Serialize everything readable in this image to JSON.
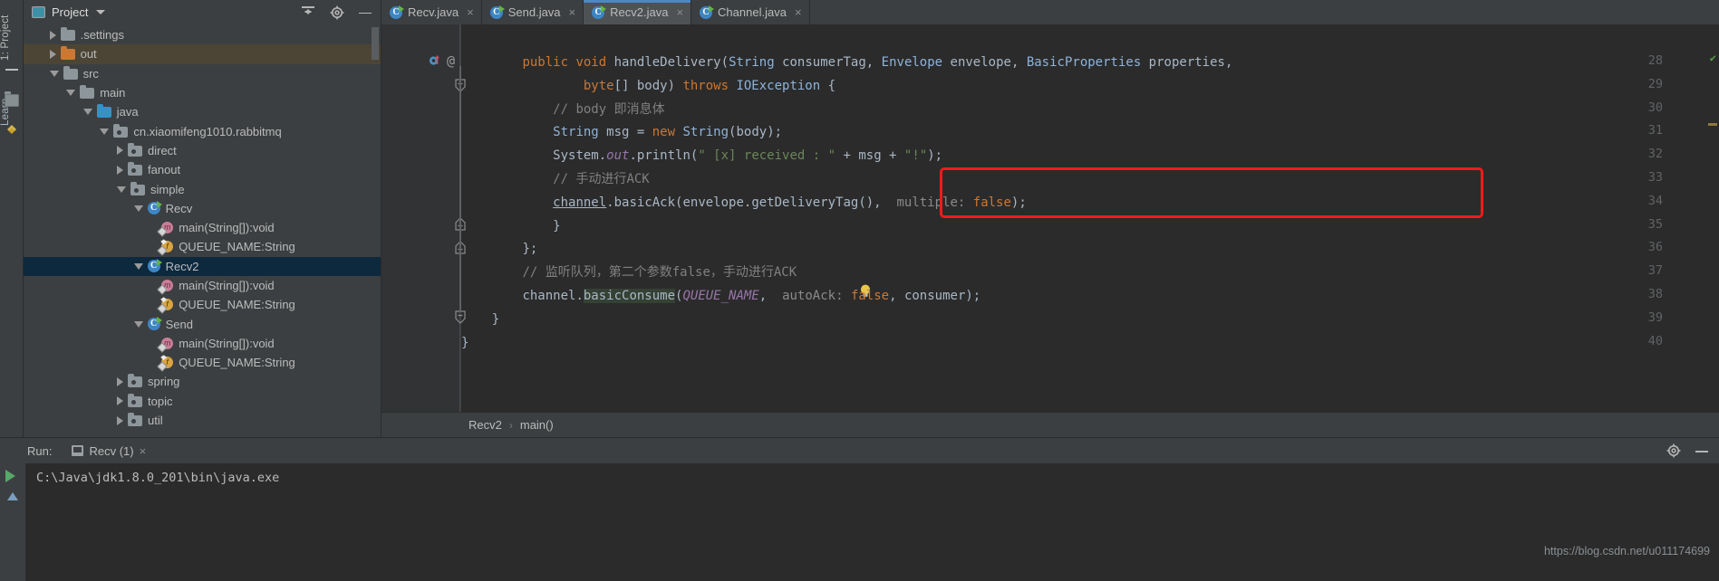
{
  "window": {
    "left_tool_tabs": [
      {
        "label": "1: Project",
        "icon": "project-icon"
      },
      {
        "label": "Learn",
        "icon": "learn-icon"
      }
    ]
  },
  "project_panel": {
    "title": "Project",
    "dropdown_icon": "chevron-down-icon",
    "actions": [
      {
        "name": "collapse-all-icon",
        "label": ""
      },
      {
        "name": "gear-icon",
        "label": ""
      },
      {
        "name": "hide-icon",
        "label": ""
      }
    ],
    "tree": [
      {
        "label": ".settings",
        "indent": 1,
        "arrow": "right",
        "icon": "folder",
        "state": "normal"
      },
      {
        "label": "out",
        "indent": 1,
        "arrow": "right",
        "icon": "folder-orange",
        "state": "out-highlight"
      },
      {
        "label": "src",
        "indent": 1,
        "arrow": "down",
        "icon": "folder",
        "state": "normal"
      },
      {
        "label": "main",
        "indent": 2,
        "arrow": "down",
        "icon": "folder",
        "state": "normal"
      },
      {
        "label": "java",
        "indent": 3,
        "arrow": "down",
        "icon": "folder-blue",
        "state": "normal"
      },
      {
        "label": "cn.xiaomifeng1010.rabbitmq",
        "indent": 4,
        "arrow": "down",
        "icon": "package",
        "state": "normal"
      },
      {
        "label": "direct",
        "indent": 5,
        "arrow": "right",
        "icon": "package",
        "state": "normal"
      },
      {
        "label": "fanout",
        "indent": 5,
        "arrow": "right",
        "icon": "package",
        "state": "normal"
      },
      {
        "label": "simple",
        "indent": 5,
        "arrow": "down",
        "icon": "package",
        "state": "normal"
      },
      {
        "label": "Recv",
        "indent": 6,
        "arrow": "down",
        "icon": "class",
        "state": "normal"
      },
      {
        "label": "main(String[]):void",
        "indent": 7,
        "arrow": "none",
        "icon": "method",
        "state": "normal"
      },
      {
        "label": "QUEUE_NAME:String",
        "indent": 7,
        "arrow": "none",
        "icon": "field",
        "state": "normal"
      },
      {
        "label": "Recv2",
        "indent": 6,
        "arrow": "down",
        "icon": "class",
        "state": "selected"
      },
      {
        "label": "main(String[]):void",
        "indent": 7,
        "arrow": "none",
        "icon": "method",
        "state": "normal"
      },
      {
        "label": "QUEUE_NAME:String",
        "indent": 7,
        "arrow": "none",
        "icon": "field",
        "state": "normal"
      },
      {
        "label": "Send",
        "indent": 6,
        "arrow": "down",
        "icon": "class",
        "state": "normal"
      },
      {
        "label": "main(String[]):void",
        "indent": 7,
        "arrow": "none",
        "icon": "method",
        "state": "normal"
      },
      {
        "label": "QUEUE_NAME:String",
        "indent": 7,
        "arrow": "none",
        "icon": "field",
        "state": "normal"
      },
      {
        "label": "spring",
        "indent": 5,
        "arrow": "right",
        "icon": "package",
        "state": "normal"
      },
      {
        "label": "topic",
        "indent": 5,
        "arrow": "right",
        "icon": "package",
        "state": "normal"
      },
      {
        "label": "util",
        "indent": 5,
        "arrow": "right",
        "icon": "package",
        "state": "normal"
      }
    ]
  },
  "editor": {
    "tabs": [
      {
        "label": "Recv.java",
        "active": false,
        "icon": "java-class-icon",
        "close": "×"
      },
      {
        "label": "Send.java",
        "active": false,
        "icon": "java-class-icon",
        "close": "×"
      },
      {
        "label": "Recv2.java",
        "active": true,
        "icon": "java-class-icon",
        "close": "×"
      },
      {
        "label": "Channel.java",
        "active": false,
        "icon": "java-class-icon",
        "close": "×"
      }
    ],
    "line_numbers": [
      "28",
      "29",
      "30",
      "31",
      "32",
      "33",
      "34",
      "35",
      "36",
      "37",
      "38",
      "39",
      "40"
    ],
    "code": {
      "l28": {
        "indent": "        ",
        "parts": [
          {
            "t": "public ",
            "c": "kw"
          },
          {
            "t": "void ",
            "c": "kw"
          },
          {
            "t": "handleDelivery",
            "c": "plain"
          },
          {
            "t": "(",
            "c": "plain"
          },
          {
            "t": "String",
            "c": "cls"
          },
          {
            "t": " consumerTag, ",
            "c": "plain"
          },
          {
            "t": "Envelope",
            "c": "cls"
          },
          {
            "t": " envelope, ",
            "c": "plain"
          },
          {
            "t": "BasicProperties",
            "c": "cls"
          },
          {
            "t": " properties,",
            "c": "plain"
          }
        ]
      },
      "l29": {
        "indent": "                ",
        "parts": [
          {
            "t": "byte",
            "c": "kw"
          },
          {
            "t": "[] body) ",
            "c": "plain"
          },
          {
            "t": "throws ",
            "c": "kw"
          },
          {
            "t": "IOException",
            "c": "cls"
          },
          {
            "t": " {",
            "c": "plain"
          }
        ]
      },
      "l30": {
        "indent": "            ",
        "parts": [
          {
            "t": "// body 即消息体",
            "c": "cmt"
          }
        ]
      },
      "l31": {
        "indent": "            ",
        "parts": [
          {
            "t": "String",
            "c": "cls"
          },
          {
            "t": " msg = ",
            "c": "plain"
          },
          {
            "t": "new ",
            "c": "kw"
          },
          {
            "t": "String",
            "c": "cls"
          },
          {
            "t": "(body);",
            "c": "plain"
          }
        ]
      },
      "l32": {
        "indent": "            ",
        "parts": [
          {
            "t": "System.",
            "c": "plain"
          },
          {
            "t": "out",
            "c": "stc"
          },
          {
            "t": ".println(",
            "c": "plain"
          },
          {
            "t": "\" [x] received : \"",
            "c": "str"
          },
          {
            "t": " + msg + ",
            "c": "plain"
          },
          {
            "t": "\"!\"",
            "c": "str"
          },
          {
            "t": ");",
            "c": "plain"
          }
        ]
      },
      "l33": {
        "indent": "            ",
        "parts": [
          {
            "t": "// 手动进行ACK",
            "c": "cmt"
          }
        ]
      },
      "l34": {
        "indent": "            ",
        "parts": [
          {
            "t": "channel",
            "c": "ident-u"
          },
          {
            "t": ".basicAck(envelope.getDeliveryTag(),  ",
            "c": "plain"
          },
          {
            "t": "multiple:",
            "c": "hint"
          },
          {
            "t": " ",
            "c": "plain"
          },
          {
            "t": "false",
            "c": "kw"
          },
          {
            "t": ");",
            "c": "plain"
          }
        ]
      },
      "l35": {
        "indent": "            ",
        "parts": [
          {
            "t": "}",
            "c": "plain"
          }
        ]
      },
      "l36": {
        "indent": "        ",
        "parts": [
          {
            "t": "};",
            "c": "plain"
          }
        ]
      },
      "l37": {
        "indent": "        ",
        "parts": [
          {
            "t": "// 监听队列，第二个参数false，手动进行ACK",
            "c": "cmt"
          }
        ]
      },
      "l38": {
        "indent": "        ",
        "parts": [
          {
            "t": "channel.",
            "c": "plain"
          },
          {
            "t": "basicConsume",
            "c": "cc-hl"
          },
          {
            "t": "(",
            "c": "plain"
          },
          {
            "t": "QUEUE_NAME",
            "c": "constant"
          },
          {
            "t": ",  ",
            "c": "plain"
          },
          {
            "t": "autoAck:",
            "c": "hint"
          },
          {
            "t": " ",
            "c": "plain"
          },
          {
            "t": "false",
            "c": "kw"
          },
          {
            "t": ", consumer);",
            "c": "plain"
          }
        ]
      },
      "l39": {
        "indent": "    ",
        "parts": [
          {
            "t": "}",
            "c": "plain"
          }
        ]
      },
      "l40": {
        "indent": "",
        "parts": [
          {
            "t": "}",
            "c": "plain"
          }
        ]
      }
    },
    "annotation": {
      "name": "red-highlight-box",
      "color": "#f41a1a",
      "covers_lines": [
        "33",
        "34"
      ]
    },
    "gutter_marks": {
      "line28_override": "override-icon",
      "line28_annotation": "@",
      "line38_intention": "lightbulb-icon"
    },
    "breadcrumb": [
      "Recv2",
      "main()"
    ],
    "breadcrumb_separator": "›"
  },
  "run_panel": {
    "label": "Run:",
    "tab_label": "Recv (1)",
    "tab_close": "×",
    "console_text": "C:\\Java\\jdk1.8.0_201\\bin\\java.exe",
    "buttons": [
      {
        "name": "run-button",
        "icon": "play-icon"
      },
      {
        "name": "rerun-up-button",
        "icon": "arrow-up-icon"
      }
    ],
    "header_actions": [
      {
        "name": "gear-icon"
      },
      {
        "name": "hide-icon"
      }
    ]
  },
  "watermark": "https://blog.csdn.net/u011174699",
  "colors": {
    "accent_tab": "#4a88c7",
    "selection": "#0d293e",
    "out_highlight": "#4c4536",
    "annotation_red": "#f41a1a",
    "editor_bg": "#2b2b2b",
    "panel_bg": "#3c3f41"
  }
}
